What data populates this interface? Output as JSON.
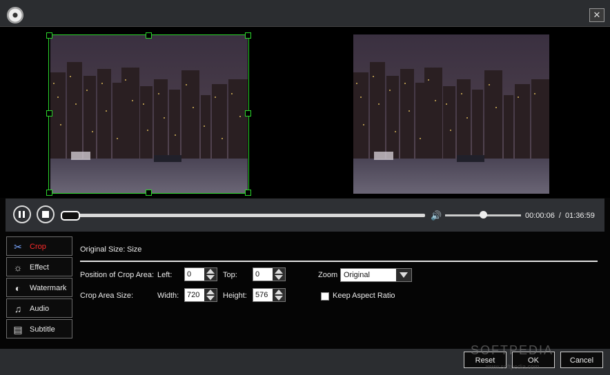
{
  "window": {
    "close_label": "✕"
  },
  "player": {
    "current_time": "00:00:06",
    "separator": "/",
    "total_time": "01:36:59",
    "volume_level": 0.5,
    "seek_position": 0.0
  },
  "tabs": [
    {
      "label": "Crop",
      "icon": "scissors-icon",
      "active": true
    },
    {
      "label": "Effect",
      "icon": "effect-icon",
      "active": false
    },
    {
      "label": "Watermark",
      "icon": "watermark-icon",
      "active": false
    },
    {
      "label": "Audio",
      "icon": "music-note-icon",
      "active": false
    },
    {
      "label": "Subtitle",
      "icon": "subtitle-icon",
      "active": false
    }
  ],
  "crop": {
    "original_size_label": "Original Size:",
    "original_size_value": "Size",
    "position_label": "Position of Crop Area:",
    "left_label": "Left:",
    "left_value": "0",
    "top_label": "Top:",
    "top_value": "0",
    "size_label": "Crop Area Size:",
    "width_label": "Width:",
    "width_value": "720",
    "height_label": "Height:",
    "height_value": "576",
    "zoom_label": "Zoom",
    "zoom_value": "Original",
    "keep_aspect_label": "Keep Aspect Ratio",
    "keep_aspect_checked": false
  },
  "footer": {
    "reset_label": "Reset",
    "ok_label": "OK",
    "cancel_label": "Cancel"
  },
  "watermark": {
    "text": "SOFTPEDIA",
    "sub": "www.softpedia.com"
  }
}
